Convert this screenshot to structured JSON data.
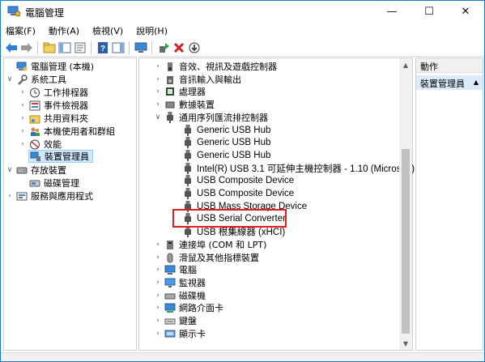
{
  "window": {
    "title": "電腦管理",
    "minimize_glyph": "—",
    "maximize_glyph": "☐",
    "close_glyph": "✕"
  },
  "menu": [
    "檔案(F)",
    "動作(A)",
    "檢視(V)",
    "說明(H)"
  ],
  "toolbar_icons": [
    "back-arrow-icon",
    "forward-arrow-icon",
    "up-folder-icon",
    "show-hide-tree-icon",
    "properties-icon",
    "help-icon",
    "action-pane-icon",
    "monitor-icon",
    "update-driver-icon",
    "uninstall-icon",
    "scan-hardware-icon"
  ],
  "left_tree": [
    {
      "label": "電腦管理 (本機)",
      "expander": "",
      "icon": "computer-management-icon"
    },
    {
      "label": "系統工具",
      "expander": "∨",
      "icon": "tools-icon"
    },
    {
      "label": "工作排程器",
      "expander": "›",
      "icon": "clock-icon"
    },
    {
      "label": "事件檢視器",
      "expander": "›",
      "icon": "event-viewer-icon"
    },
    {
      "label": "共用資料夾",
      "expander": "›",
      "icon": "shared-folder-icon"
    },
    {
      "label": "本機使用者和群組",
      "expander": "›",
      "icon": "users-icon"
    },
    {
      "label": "效能",
      "expander": "›",
      "icon": "performance-icon"
    },
    {
      "label": "裝置管理員",
      "expander": "",
      "icon": "device-manager-icon"
    },
    {
      "label": "存放裝置",
      "expander": "∨",
      "icon": "storage-icon"
    },
    {
      "label": "磁碟管理",
      "expander": "",
      "icon": "disk-management-icon"
    },
    {
      "label": "服務與應用程式",
      "expander": "›",
      "icon": "services-icon"
    }
  ],
  "device_tree": [
    {
      "label": "音效、視訊及遊戲控制器",
      "expander": "›",
      "icon": "audio-icon"
    },
    {
      "label": "音訊輸入與輸出",
      "expander": "›",
      "icon": "speaker-icon"
    },
    {
      "label": "處理器",
      "expander": "›",
      "icon": "processor-icon"
    },
    {
      "label": "數據裝置",
      "expander": "›",
      "icon": "drive-icon"
    },
    {
      "label": "通用序列匯流排控制器",
      "expander": "∨",
      "icon": "usb-icon"
    },
    {
      "label": "Generic USB Hub",
      "expander": "",
      "icon": "usb-icon"
    },
    {
      "label": "Generic USB Hub",
      "expander": "",
      "icon": "usb-icon"
    },
    {
      "label": "Generic USB Hub",
      "expander": "",
      "icon": "usb-icon"
    },
    {
      "label": "Intel(R) USB 3.1 可延伸主機控制器 - 1.10 (Microsoft)",
      "expander": "",
      "icon": "usb-icon"
    },
    {
      "label": "USB Composite Device",
      "expander": "",
      "icon": "usb-icon"
    },
    {
      "label": "USB Composite Device",
      "expander": "",
      "icon": "usb-icon"
    },
    {
      "label": "USB Mass Storage Device",
      "expander": "",
      "icon": "usb-icon"
    },
    {
      "label": "USB Serial Converter",
      "expander": "",
      "icon": "usb-icon"
    },
    {
      "label": "USB 根集線器 (xHCI)",
      "expander": "",
      "icon": "usb-icon"
    },
    {
      "label": "連接埠 (COM 和 LPT)",
      "expander": "›",
      "icon": "port-icon"
    },
    {
      "label": "滑鼠及其他指標裝置",
      "expander": "›",
      "icon": "mouse-icon"
    },
    {
      "label": "電腦",
      "expander": "›",
      "icon": "computer-icon"
    },
    {
      "label": "監視器",
      "expander": "›",
      "icon": "monitor-icon"
    },
    {
      "label": "磁碟機",
      "expander": "›",
      "icon": "disk-drive-icon"
    },
    {
      "label": "網路介面卡",
      "expander": "›",
      "icon": "network-adapter-icon"
    },
    {
      "label": "鍵盤",
      "expander": "›",
      "icon": "keyboard-icon"
    },
    {
      "label": "顯示卡",
      "expander": "›",
      "icon": "display-adapter-icon"
    }
  ],
  "actions": {
    "header": "動作",
    "item": "裝置管理員",
    "item_arrow": "▲"
  },
  "colors": {
    "accent_blue": "#1979ca",
    "selection": "#cde8ff",
    "highlight_red": "#e02020"
  }
}
